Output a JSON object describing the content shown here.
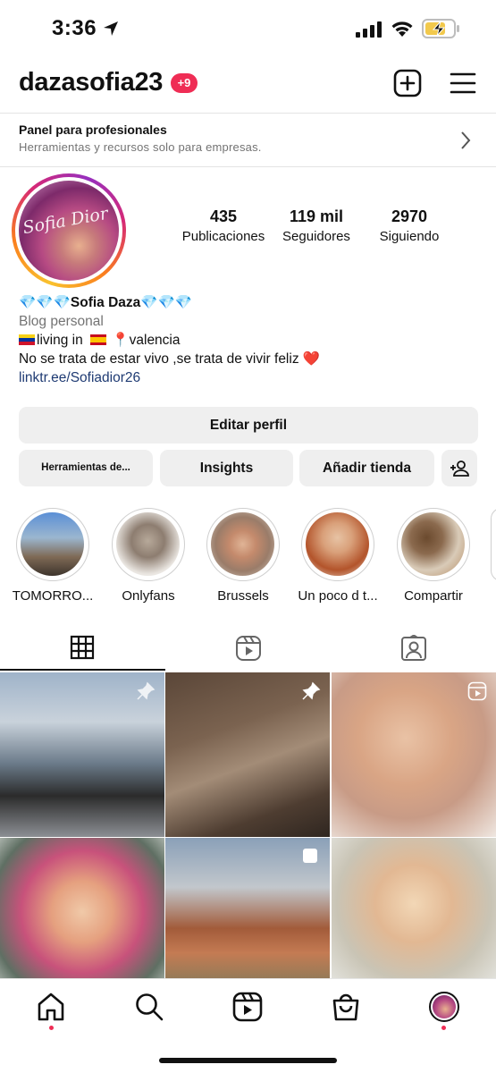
{
  "status_bar": {
    "time": "3:36"
  },
  "header": {
    "username": "dazasofia23",
    "notifications": "+9"
  },
  "pro_panel": {
    "title": "Panel para profesionales",
    "subtitle": "Herramientas y recursos solo para empresas."
  },
  "profile": {
    "avatar_signature": "Sofia Dior",
    "stats": [
      {
        "value": "435",
        "label": "Publicaciones"
      },
      {
        "value": "119 mil",
        "label": "Seguidores"
      },
      {
        "value": "2970",
        "label": "Siguiendo"
      }
    ],
    "bio": {
      "name": "💎💎💎Sofia Daza💎💎💎",
      "category": "Blog personal",
      "line1_a": "living in",
      "line1_b": "📍valencia",
      "line2": "No se trata de estar vivo ,se trata de vivir feliz ❤️",
      "link": "linktr.ee/Sofiadior26"
    }
  },
  "buttons": {
    "edit": "Editar perfil",
    "tools": "Herramientas de...",
    "insights": "Insights",
    "shop": "Añadir tienda"
  },
  "highlights": [
    {
      "label": "TOMORRO..."
    },
    {
      "label": "Onlyfans"
    },
    {
      "label": "Brussels"
    },
    {
      "label": "Un poco d t..."
    },
    {
      "label": "Compartir"
    }
  ],
  "colors": {
    "accent": "#ef2d55",
    "link": "#1f3b73",
    "button_bg": "#efefef",
    "muted": "#737373"
  }
}
